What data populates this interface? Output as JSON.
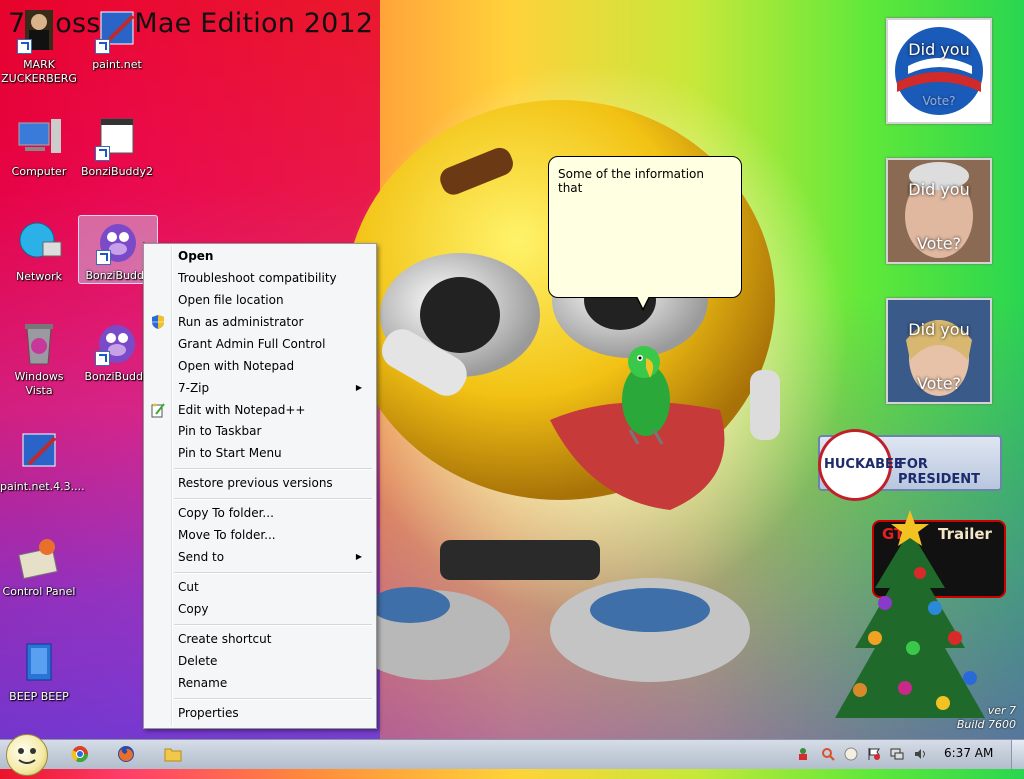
{
  "wallpaper": {
    "title": "7 Gossip Mae Edition 2012"
  },
  "desktop": {
    "icons": [
      {
        "label": "MARK\nZUCKERBERG",
        "icon": "person-icon"
      },
      {
        "label": "paint.net",
        "icon": "paint-net-icon"
      },
      {
        "label": "Computer",
        "icon": "computer-icon"
      },
      {
        "label": "BonziBuddy2",
        "icon": "bonzi-buddy-icon"
      },
      {
        "label": "Network",
        "icon": "network-icon"
      },
      {
        "label": "BonziBuddy",
        "icon": "bonzi-buddy-icon"
      },
      {
        "label": "Windows Vista",
        "icon": "recycle-bin-icon"
      },
      {
        "label": "BonziBuddy",
        "icon": "bonzi-buddy-icon"
      },
      {
        "label": "paint.net.4.3....",
        "icon": "paint-net-icon"
      },
      {
        "label": "Control Panel",
        "icon": "control-panel-icon"
      },
      {
        "label": "BEEP BEEP",
        "icon": "file-icon"
      }
    ]
  },
  "context_menu": {
    "items": [
      {
        "label": "Open",
        "bold": true
      },
      {
        "label": "Troubleshoot compatibility"
      },
      {
        "label": "Open file location"
      },
      {
        "label": "Run as administrator",
        "icon": "uac-shield-icon"
      },
      {
        "label": "Grant Admin Full Control"
      },
      {
        "label": "Open with Notepad"
      },
      {
        "label": "7-Zip",
        "submenu": true
      },
      {
        "label": "Edit with Notepad++",
        "icon": "notepad-plus-icon"
      },
      {
        "label": "Pin to Taskbar"
      },
      {
        "label": "Pin to Start Menu"
      },
      {
        "label": "Restore previous versions"
      },
      {
        "label": "Copy To folder..."
      },
      {
        "label": "Move To folder..."
      },
      {
        "label": "Send to",
        "submenu": true
      },
      {
        "label": "Cut"
      },
      {
        "label": "Copy"
      },
      {
        "label": "Create shortcut"
      },
      {
        "label": "Delete"
      },
      {
        "label": "Rename"
      },
      {
        "label": "Properties"
      }
    ]
  },
  "bubble": {
    "text": "Some of the information that"
  },
  "gadgets": {
    "vote1": "Did you",
    "vote1b": "Vote?",
    "vote2a": "Did you",
    "vote2b": "Vote?",
    "vote3a": "Did you",
    "vote3b": "Vote?",
    "huckabee": "HUCKABEE",
    "for_president": "FOR PRESIDENT",
    "trailer_a": "GT",
    "trailer_b": "Trailer"
  },
  "watermark": {
    "line1": "ver 7",
    "line2": "Build 7600"
  },
  "taskbar": {
    "pinned": [
      "chrome-icon",
      "firefox-icon",
      "folder-icon"
    ],
    "clock": "6:37 AM"
  },
  "colors": {
    "menu_bg": "#f5f6f7",
    "bubble_bg": "#ffffe1",
    "taskbar": "#c3ccd9"
  }
}
